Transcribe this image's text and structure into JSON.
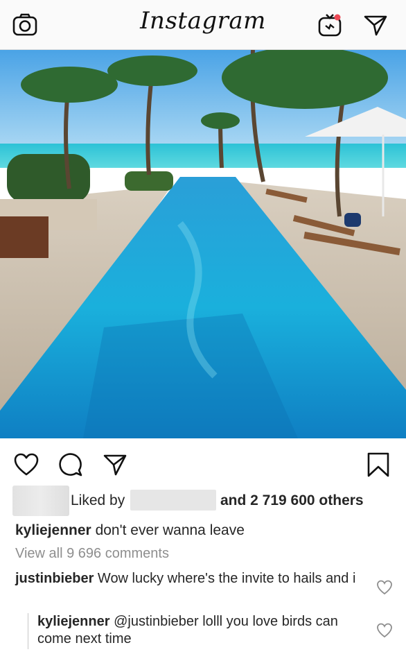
{
  "header": {
    "logo_text": "Instagram",
    "icons": [
      "camera-icon",
      "igtv-icon",
      "direct-message-icon"
    ],
    "notification_dot_color": "#ed4956"
  },
  "post": {
    "image_description": "Resort lap pool leading to the ocean with palm trees and lounge chairs",
    "actions": [
      "heart-icon",
      "comment-icon",
      "share-icon",
      "bookmark-icon"
    ],
    "likes": {
      "liked_by_label": "Liked by",
      "and_others": "and 2 719 600 others"
    },
    "caption": {
      "username": "kyliejenner",
      "text": "don't ever wanna leave"
    },
    "view_all_comments": "View all 9 696 comments",
    "comments": [
      {
        "username": "justinbieber",
        "text": "Wow lucky where's the invite to hails and i"
      },
      {
        "username": "kyliejenner",
        "text": "@justinbieber lolll you love birds can come next time"
      }
    ]
  }
}
